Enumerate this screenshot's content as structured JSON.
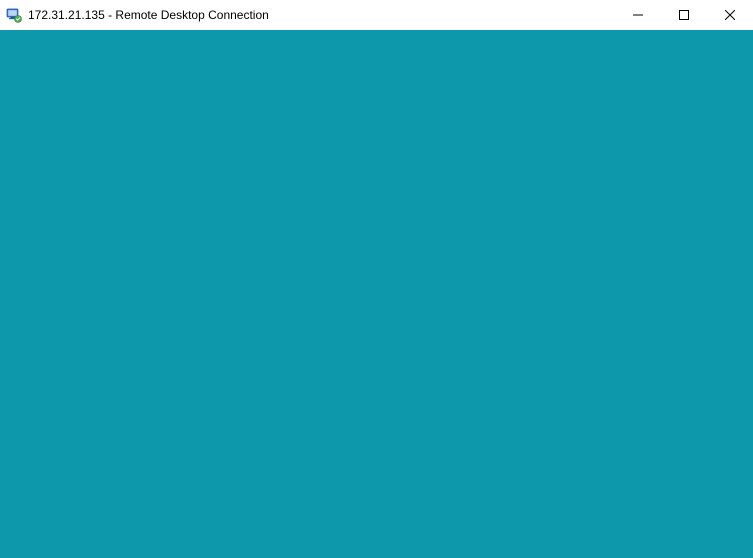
{
  "window": {
    "ip": "172.31.21.135",
    "app_name": "Remote Desktop Connection",
    "title": "172.31.21.135 - Remote Desktop Connection"
  },
  "remote": {
    "background_color": "#0d98ab"
  }
}
